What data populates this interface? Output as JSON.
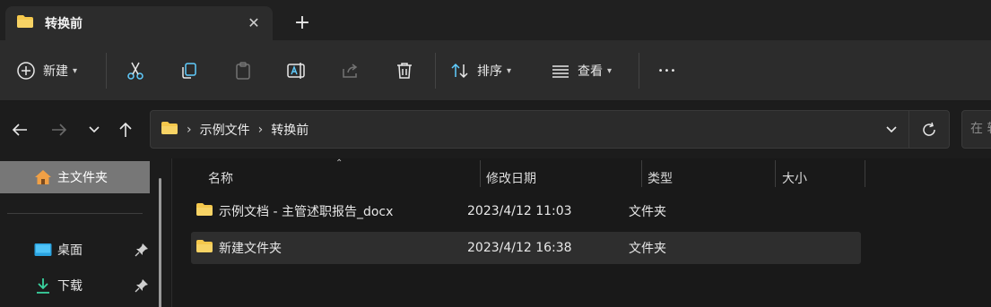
{
  "tab": {
    "title": "转换前",
    "close_glyph": "✕",
    "new_tab_glyph": "+"
  },
  "toolbar": {
    "new_label": "新建",
    "sort_label": "排序",
    "view_label": "查看",
    "more_glyph": "•••"
  },
  "address": {
    "crumbs": [
      "示例文件",
      "转换前"
    ],
    "search_placeholder": "在 转"
  },
  "sidebar": {
    "home_label": "主文件夹",
    "items": [
      {
        "label": "桌面"
      },
      {
        "label": "下载"
      }
    ]
  },
  "list": {
    "columns": [
      "名称",
      "修改日期",
      "类型",
      "大小"
    ],
    "rows": [
      {
        "name": "示例文档 - 主管述职报告_docx",
        "date": "2023/4/12 11:03",
        "type": "文件夹"
      },
      {
        "name": "新建文件夹",
        "date": "2023/4/12 16:38",
        "type": "文件夹"
      }
    ]
  },
  "colors": {
    "folder": "#f5c84c",
    "accent": "#60cdff",
    "selected_row": "#2e2e2e"
  }
}
